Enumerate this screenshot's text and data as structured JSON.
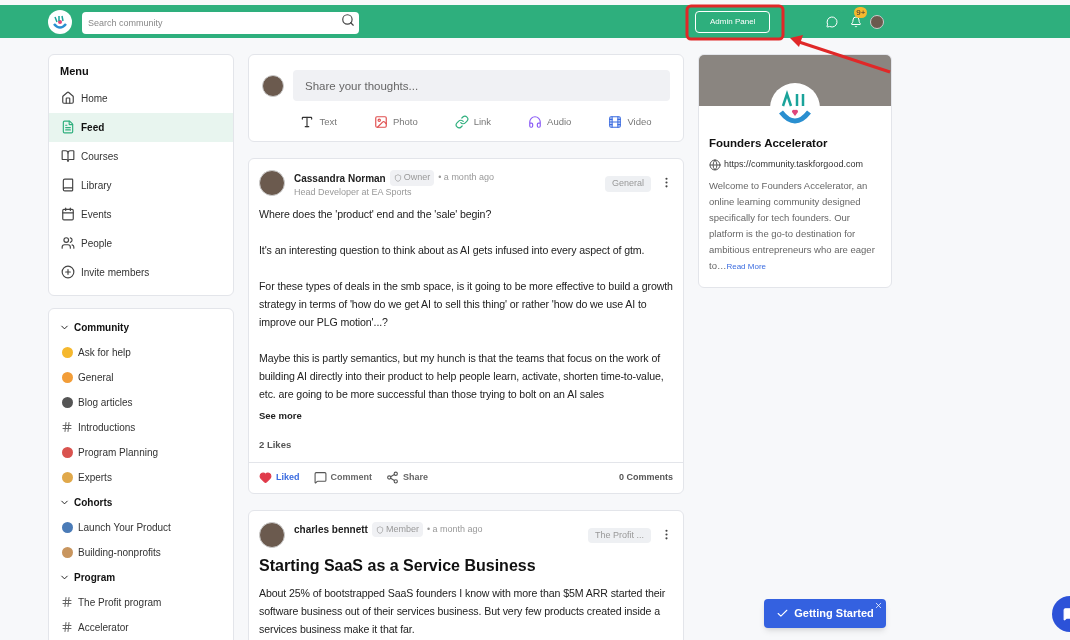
{
  "topbar": {
    "search": {
      "placeholder": "Search community"
    },
    "admin_button": "Admin Panel",
    "notification_badge": "9+"
  },
  "menu": {
    "title": "Menu",
    "items": [
      {
        "label": "Home",
        "kind": "home",
        "selected": false
      },
      {
        "label": "Feed",
        "kind": "feed",
        "selected": true
      },
      {
        "label": "Courses",
        "kind": "book",
        "selected": false
      },
      {
        "label": "Library",
        "kind": "library",
        "selected": false
      },
      {
        "label": "Events",
        "kind": "calendar",
        "selected": false
      },
      {
        "label": "People",
        "kind": "people",
        "selected": false
      },
      {
        "label": "Invite members",
        "kind": "plus",
        "selected": false
      }
    ]
  },
  "groups": [
    {
      "title": "Community",
      "expanded": true,
      "items": [
        {
          "label": "Ask for help",
          "kind": "emoji",
          "color": "#f5b82e"
        },
        {
          "label": "General",
          "kind": "emoji",
          "color": "#f29d38"
        },
        {
          "label": "Blog articles",
          "kind": "emoji",
          "color": "#555555"
        },
        {
          "label": "Introductions",
          "kind": "hash"
        },
        {
          "label": "Program Planning",
          "kind": "emoji",
          "color": "#d9534f"
        },
        {
          "label": "Experts",
          "kind": "emoji",
          "color": "#e0a84a"
        }
      ]
    },
    {
      "title": "Cohorts",
      "expanded": true,
      "items": [
        {
          "label": "Launch Your Product",
          "kind": "emoji",
          "color": "#4a7bb7"
        },
        {
          "label": "Building-nonprofits",
          "kind": "emoji",
          "color": "#c8955e"
        }
      ]
    },
    {
      "title": "Program",
      "expanded": true,
      "items": [
        {
          "label": "The Profit program",
          "kind": "hash"
        },
        {
          "label": "Accelerator",
          "kind": "hash"
        }
      ]
    }
  ],
  "composer": {
    "placeholder": "Share your thoughts...",
    "options": [
      {
        "label": "Text",
        "kind": "text"
      },
      {
        "label": "Photo",
        "kind": "photo"
      },
      {
        "label": "Link",
        "kind": "link"
      },
      {
        "label": "Audio",
        "kind": "audio"
      },
      {
        "label": "Video",
        "kind": "video"
      }
    ]
  },
  "posts": [
    {
      "author": "Cassandra Norman",
      "role": "Owner",
      "time": "• a month ago",
      "subtitle": "Head Developer at EA Sports",
      "tag": "General",
      "paragraphs": [
        "Where does the 'product' end and the 'sale' begin?",
        "It's an interesting question to think about as AI gets infused into every aspect of gtm.",
        "For these types of deals in the smb space, is it going to be more effective to build a growth strategy in terms of 'how do we get AI to sell this thing' or rather 'how do we use AI to improve our PLG motion'...?",
        "Maybe this is partly semantics, but my hunch is that the teams that focus on the work of building AI directly into their product to help people learn, activate, shorten time-to-value, etc. are going to be more successful than those trying to bolt on an AI sales"
      ],
      "see_more": "See more",
      "likes": "2 Likes",
      "actions": [
        {
          "label": "Liked",
          "kind": "like",
          "selected": true
        },
        {
          "label": "Comment",
          "kind": "comment"
        },
        {
          "label": "Share",
          "kind": "share"
        }
      ],
      "comments": "0 Comments"
    },
    {
      "author": "charles bennett",
      "role": "Member",
      "time": "• a month ago",
      "tag": "The Profit ...",
      "title": "Starting SaaS as a Service Business",
      "paragraphs": [
        "About 25% of bootstrapped SaaS founders I know with more than $5M ARR started their software business out of their services business. But very few products created inside a services business make it that far."
      ]
    }
  ],
  "community_card": {
    "name": "Founders Accelerator",
    "url": "https://community.taskforgood.com",
    "description": "Welcome to Founders Accelerator, an online learning community designed specifically for tech founders. Our platform is the go-to destination for ambitious entrepreneurs who are eager to…",
    "read_more": "Read More"
  },
  "getting_started": "Getting Started"
}
